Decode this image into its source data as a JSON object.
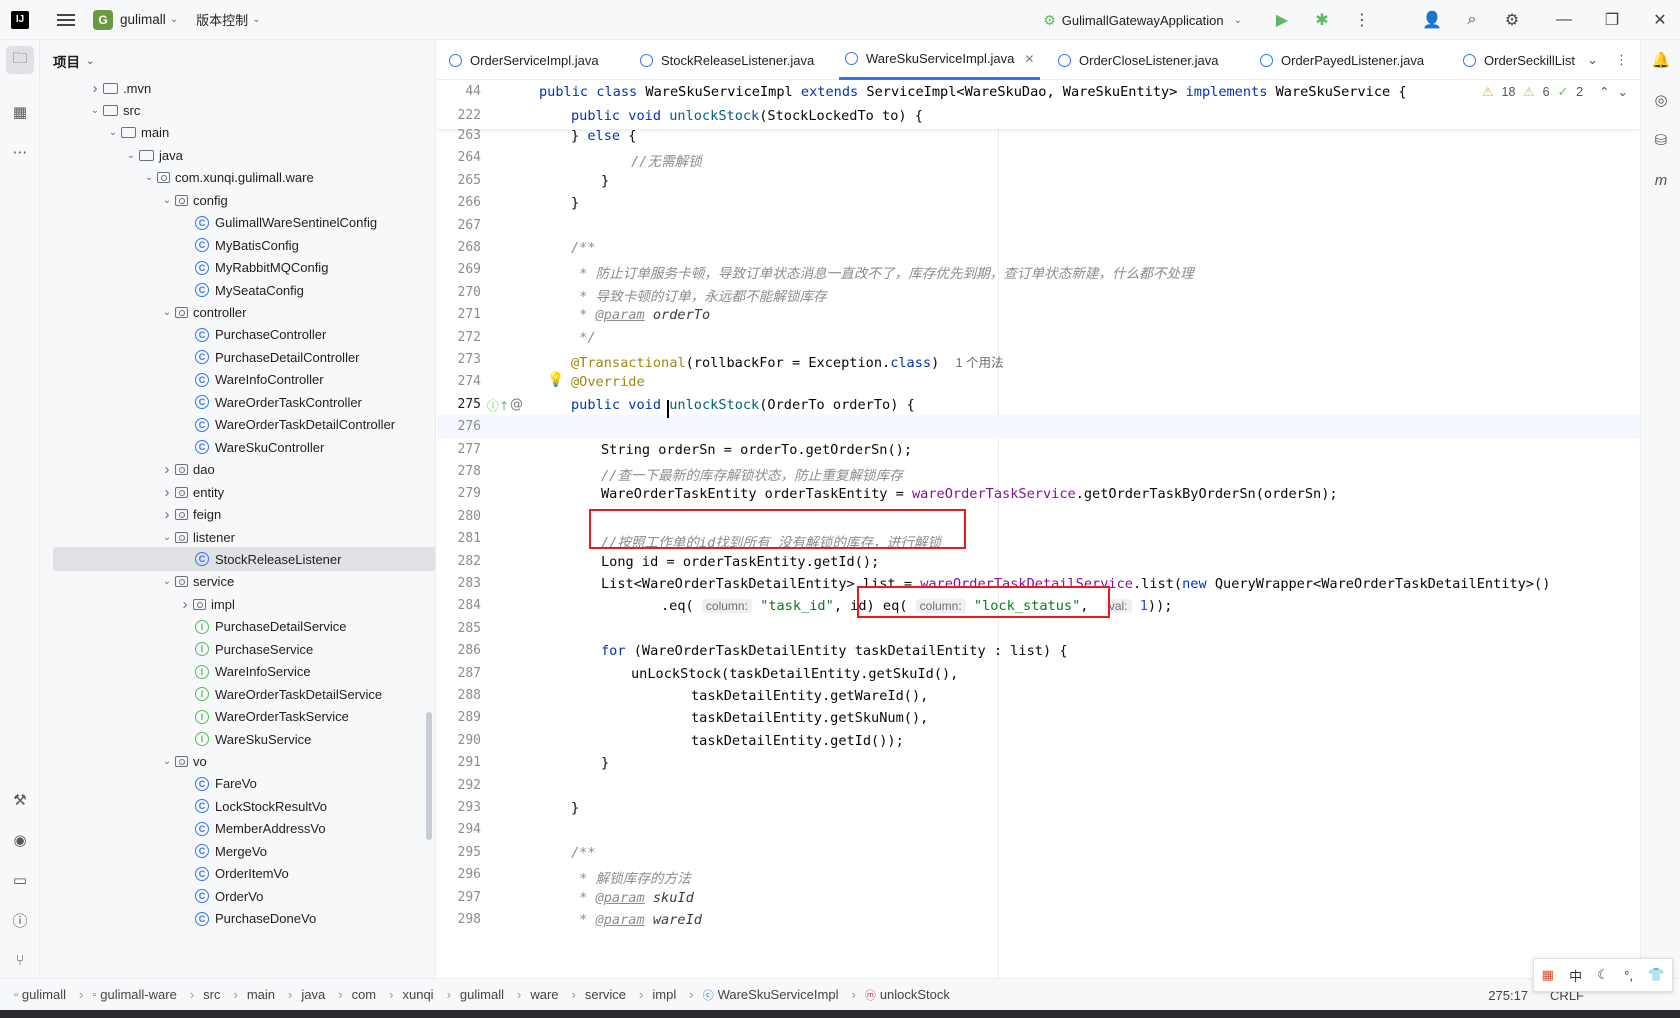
{
  "titlebar": {
    "project_badge": "G",
    "project_name": "gulimall",
    "vcs_label": "版本控制",
    "run_config": "GulimallGatewayApplication"
  },
  "project_panel": {
    "title": "项目",
    "tree": [
      {
        "label": ".mvn",
        "kind": "folder",
        "level": 3,
        "arrow": "▶"
      },
      {
        "label": "src",
        "kind": "folder",
        "level": 3,
        "arrow": "▼"
      },
      {
        "label": "main",
        "kind": "folder",
        "level": 4,
        "arrow": "▼"
      },
      {
        "label": "java",
        "kind": "folder",
        "level": 5,
        "arrow": "▼"
      },
      {
        "label": "com.xunqi.gulimall.ware",
        "kind": "pkg",
        "level": 6,
        "arrow": "▼"
      },
      {
        "label": "config",
        "kind": "pkg",
        "level": 7,
        "arrow": "▼"
      },
      {
        "label": "GulimallWareSentinelConfig",
        "kind": "class",
        "level": 8,
        "arrow": ""
      },
      {
        "label": "MyBatisConfig",
        "kind": "class",
        "level": 8,
        "arrow": ""
      },
      {
        "label": "MyRabbitMQConfig",
        "kind": "class",
        "level": 8,
        "arrow": ""
      },
      {
        "label": "MySeataConfig",
        "kind": "class",
        "level": 8,
        "arrow": ""
      },
      {
        "label": "controller",
        "kind": "pkg",
        "level": 7,
        "arrow": "▼"
      },
      {
        "label": "PurchaseController",
        "kind": "class",
        "level": 8,
        "arrow": ""
      },
      {
        "label": "PurchaseDetailController",
        "kind": "class",
        "level": 8,
        "arrow": ""
      },
      {
        "label": "WareInfoController",
        "kind": "class",
        "level": 8,
        "arrow": ""
      },
      {
        "label": "WareOrderTaskController",
        "kind": "class",
        "level": 8,
        "arrow": ""
      },
      {
        "label": "WareOrderTaskDetailController",
        "kind": "class",
        "level": 8,
        "arrow": ""
      },
      {
        "label": "WareSkuController",
        "kind": "class",
        "level": 8,
        "arrow": ""
      },
      {
        "label": "dao",
        "kind": "pkg",
        "level": 7,
        "arrow": "▶"
      },
      {
        "label": "entity",
        "kind": "pkg",
        "level": 7,
        "arrow": "▶"
      },
      {
        "label": "feign",
        "kind": "pkg",
        "level": 7,
        "arrow": "▶"
      },
      {
        "label": "listener",
        "kind": "pkg",
        "level": 7,
        "arrow": "▼"
      },
      {
        "label": "StockReleaseListener",
        "kind": "class",
        "level": 8,
        "arrow": "",
        "selected": true
      },
      {
        "label": "service",
        "kind": "pkg",
        "level": 7,
        "arrow": "▼"
      },
      {
        "label": "impl",
        "kind": "pkg",
        "level": 8,
        "arrow": "▶"
      },
      {
        "label": "PurchaseDetailService",
        "kind": "iface",
        "level": 8,
        "arrow": ""
      },
      {
        "label": "PurchaseService",
        "kind": "iface",
        "level": 8,
        "arrow": ""
      },
      {
        "label": "WareInfoService",
        "kind": "iface",
        "level": 8,
        "arrow": ""
      },
      {
        "label": "WareOrderTaskDetailService",
        "kind": "iface",
        "level": 8,
        "arrow": ""
      },
      {
        "label": "WareOrderTaskService",
        "kind": "iface",
        "level": 8,
        "arrow": ""
      },
      {
        "label": "WareSkuService",
        "kind": "iface",
        "level": 8,
        "arrow": ""
      },
      {
        "label": "vo",
        "kind": "pkg",
        "level": 7,
        "arrow": "▼"
      },
      {
        "label": "FareVo",
        "kind": "class",
        "level": 8,
        "arrow": ""
      },
      {
        "label": "LockStockResultVo",
        "kind": "class",
        "level": 8,
        "arrow": ""
      },
      {
        "label": "MemberAddressVo",
        "kind": "class",
        "level": 8,
        "arrow": ""
      },
      {
        "label": "MergeVo",
        "kind": "class",
        "level": 8,
        "arrow": ""
      },
      {
        "label": "OrderItemVo",
        "kind": "class",
        "level": 8,
        "arrow": ""
      },
      {
        "label": "OrderVo",
        "kind": "class",
        "level": 8,
        "arrow": ""
      },
      {
        "label": "PurchaseDoneVo",
        "kind": "class",
        "level": 8,
        "arrow": ""
      }
    ]
  },
  "tabs": [
    {
      "label": "OrderServiceImpl.java",
      "active": false
    },
    {
      "label": "StockReleaseListener.java",
      "active": false
    },
    {
      "label": "WareSkuServiceImpl.java",
      "active": true
    },
    {
      "label": "OrderCloseListener.java",
      "active": false
    },
    {
      "label": "OrderPayedListener.java",
      "active": false
    },
    {
      "label": "OrderSeckillList",
      "active": false
    }
  ],
  "inspections": {
    "warnings": "18",
    "weak_warnings": "6",
    "typos": "2"
  },
  "editor": {
    "usage_hint": "1 个用法",
    "hint_column": "column:",
    "hint_val": "val:",
    "line_numbers": [
      "44",
      "222",
      "263",
      "264",
      "265",
      "266",
      "267",
      "268",
      "269",
      "270",
      "271",
      "272",
      "273",
      "274",
      "275",
      "276",
      "277",
      "278",
      "279",
      "280",
      "281",
      "282",
      "283",
      "284",
      "285",
      "286",
      "287",
      "288",
      "289",
      "290",
      "291",
      "292",
      "293",
      "294",
      "295",
      "296",
      "297",
      "298"
    ],
    "comments": {
      "c264": "//无需解锁",
      "c269": " * 防止订单服务卡顿，导致订单状态消息一直改不了，库存优先到期，查订单状态新建，什么都不处理",
      "c270": " * 导致卡顿的订单，永远都不能解锁库存",
      "c278": "//查一下最新的库存解锁状态，防止重复解锁库存",
      "c281": "//按照工作单的id找到所有 没有解锁的库存，进行解锁",
      "c296": " * 解锁库存的方法"
    },
    "strings": {
      "task_id": "\"task_id\"",
      "lock_status": "\"lock_status\""
    }
  },
  "statusbar": {
    "breadcrumbs": [
      "gulimall",
      "gulimall-ware",
      "src",
      "main",
      "java",
      "com",
      "xunqi",
      "gulimall",
      "ware",
      "service",
      "impl",
      "WareSkuServiceImpl",
      "unlockStock"
    ],
    "position": "275:17",
    "line_sep": "CRLF"
  },
  "ime": {
    "lang": "中"
  }
}
